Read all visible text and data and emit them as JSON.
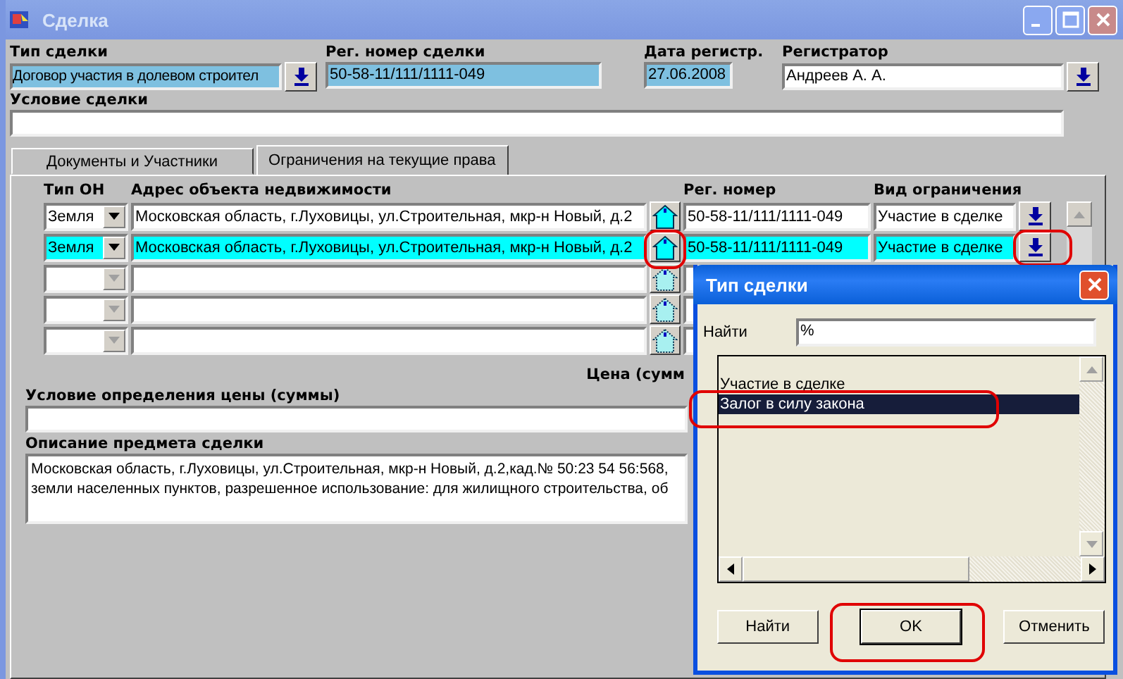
{
  "window": {
    "title": "Сделка",
    "active": false
  },
  "deal": {
    "type_label": "Тип сделки",
    "type_value": "Договор участия в долевом строител",
    "reg_label": "Рег. номер сделки",
    "reg_value": "50-58-11/111/1111-049",
    "date_label": "Дата регистр.",
    "date_value": "27.06.2008",
    "registrar_label": "Регистратор",
    "registrar_value": "Андреев А. А.",
    "condition_label": "Условие сделки"
  },
  "tabs": [
    {
      "label": "Документы и Участники",
      "selected": false
    },
    {
      "label": "Ограничения на текущие права",
      "selected": true
    }
  ],
  "grid": {
    "columns": [
      "Тип ОН",
      "Адрес объекта недвижимости",
      "Рег. номер",
      "Вид ограничения"
    ],
    "rows": [
      {
        "type": "Земля",
        "address": "Московская область, г.Луховицы, ул.Строительная, мкр-н Новый, д.2",
        "reg": "50-58-11/111/1111-049",
        "restriction": "Участие в сделке",
        "selected": false,
        "disabled": false
      },
      {
        "type": "Земля",
        "address": "Московская область, г.Луховицы, ул.Строительная, мкр-н Новый, д.2",
        "reg": "50-58-11/111/1111-049",
        "restriction": "Участие в сделке",
        "selected": true,
        "disabled": false
      },
      {
        "selected": false,
        "disabled": true
      },
      {
        "selected": false,
        "disabled": true
      },
      {
        "selected": false,
        "disabled": true
      }
    ]
  },
  "price_label": "Цена (сумм",
  "price_condition_label": "Условие определения цены (суммы)",
  "subject": {
    "label": "Описание предмета сделки",
    "lines": [
      "Московская область, г.Луховицы, ул.Строительная, мкр-н Новый, д.2,кад.№ 50:23 54 56:568,",
      "земли населенных пунктов, разрешенное использование: для жилищного строительства, об"
    ]
  },
  "dialog": {
    "title": "Тип сделки",
    "search_label": "Найти",
    "search_value": "%",
    "items": [
      {
        "label": "Участие в сделке",
        "selected": false
      },
      {
        "label": "Залог в силу закона",
        "selected": true
      }
    ],
    "buttons": [
      {
        "label": "Найти",
        "default": false
      },
      {
        "label": "OK",
        "default": true
      },
      {
        "label": "Отменить",
        "default": false
      }
    ]
  }
}
